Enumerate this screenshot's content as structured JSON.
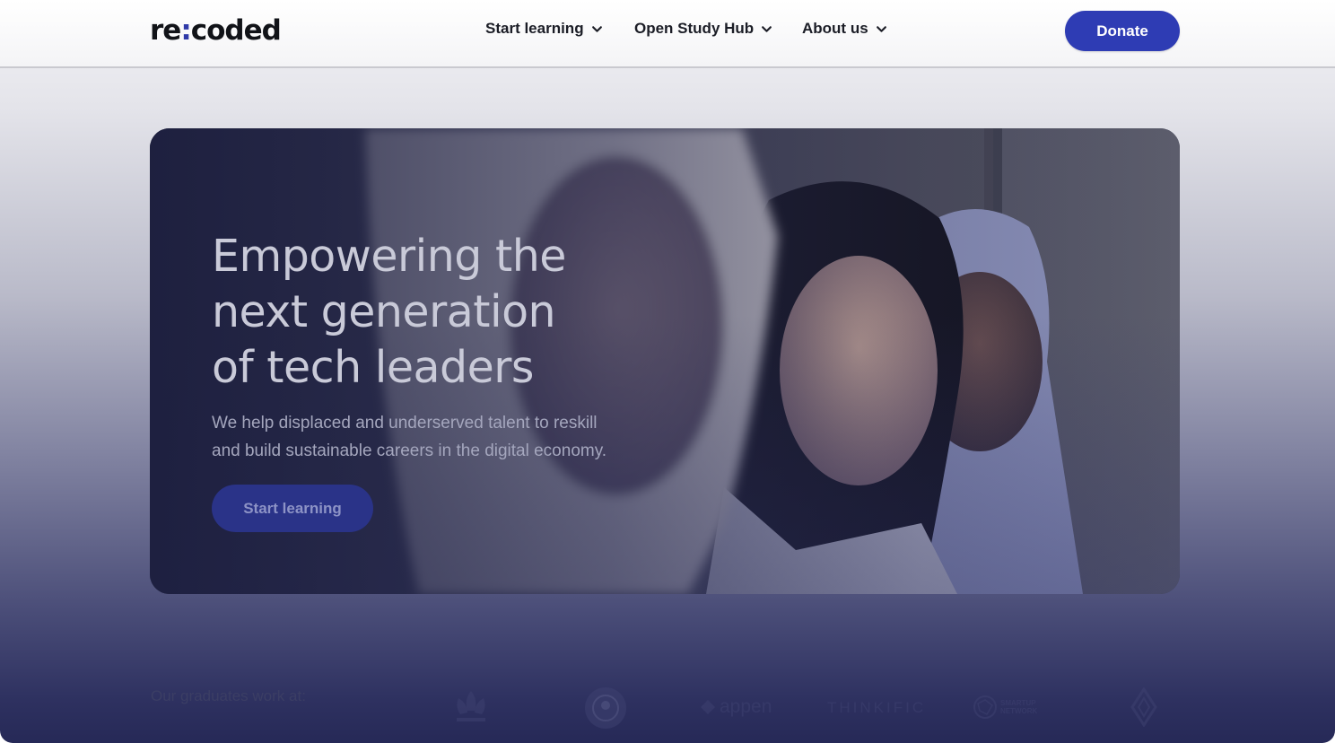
{
  "header": {
    "logo": {
      "prefix": "re",
      "colon": ":",
      "suffix": "coded"
    },
    "nav": [
      {
        "label": "Start learning"
      },
      {
        "label": "Open Study Hub"
      },
      {
        "label": "About us"
      }
    ],
    "donate_label": "Donate"
  },
  "hero": {
    "title_lines": [
      "Empowering the",
      "next generation",
      "of tech leaders"
    ],
    "subtitle_lines": [
      "We help displaced and underserved talent to reskill",
      "and build sustainable careers in the digital economy."
    ],
    "cta_label": "Start learning"
  },
  "graduates": {
    "label": "Our graduates work at:",
    "partners": [
      {
        "name": "adidas",
        "icon": "adidas-logo-icon"
      },
      {
        "name": "Starbucks",
        "icon": "starbucks-logo-icon"
      },
      {
        "name": "appen",
        "icon": "appen-logo-icon"
      },
      {
        "name": "THINKIFIC",
        "icon": "thinkific-logo-icon"
      },
      {
        "name": "SMARTUP NETWORK",
        "icon": "smartup-network-logo-icon"
      },
      {
        "name": "Renault",
        "icon": "renault-logo-icon"
      }
    ]
  },
  "colors": {
    "brand_blue": "#2e3cb4",
    "text_dark": "#1b1d26",
    "hero_title": "#c9cad8"
  }
}
